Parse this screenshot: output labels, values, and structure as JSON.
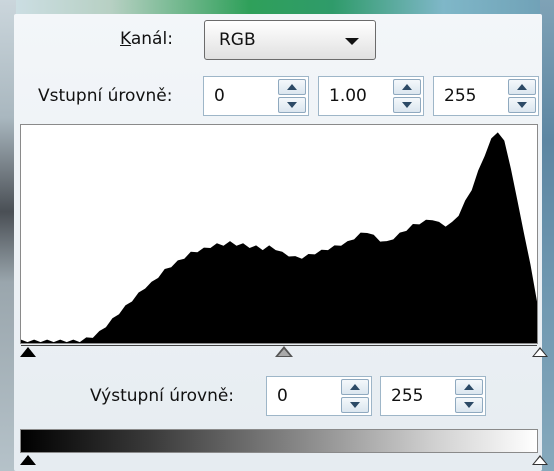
{
  "channel": {
    "label": "Kanál:",
    "selected": "RGB"
  },
  "input_levels": {
    "label": "Vstupní úrovně:",
    "black": "0",
    "gamma": "1.00",
    "white": "255"
  },
  "output_levels": {
    "label": "Výstupní úrovně:",
    "black": "0",
    "white": "255"
  },
  "histogram": {
    "fill_color": "#000000",
    "background": "#ffffff",
    "heights": [
      0.01,
      0.01,
      0.01,
      0.01,
      0.01,
      0.01,
      0.01,
      0.01,
      0.01,
      0.01,
      0.02,
      0.03,
      0.05,
      0.08,
      0.11,
      0.14,
      0.17,
      0.2,
      0.23,
      0.26,
      0.28,
      0.31,
      0.34,
      0.36,
      0.38,
      0.4,
      0.42,
      0.43,
      0.44,
      0.45,
      0.46,
      0.46,
      0.47,
      0.46,
      0.46,
      0.45,
      0.45,
      0.44,
      0.45,
      0.44,
      0.42,
      0.41,
      0.4,
      0.4,
      0.41,
      0.42,
      0.43,
      0.44,
      0.45,
      0.46,
      0.47,
      0.49,
      0.51,
      0.52,
      0.5,
      0.48,
      0.47,
      0.49,
      0.51,
      0.53,
      0.55,
      0.56,
      0.57,
      0.58,
      0.56,
      0.55,
      0.56,
      0.6,
      0.66,
      0.72,
      0.8,
      0.88,
      0.95,
      0.99,
      0.94,
      0.82,
      0.66,
      0.52,
      0.36,
      0.2
    ]
  },
  "markers": {
    "input": {
      "black": 0.0,
      "gamma": 0.5,
      "white": 1.0
    },
    "output": {
      "black": 0.0,
      "white": 1.0
    }
  }
}
